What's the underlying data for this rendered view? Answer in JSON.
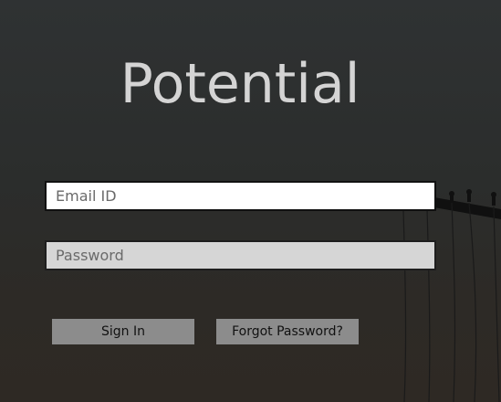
{
  "app": {
    "title": "Potential"
  },
  "login_form": {
    "email_placeholder": "Email ID",
    "email_value": "",
    "password_placeholder": "Password",
    "password_value": "",
    "sign_in_label": "Sign In",
    "forgot_password_label": "Forgot Password?"
  },
  "colors": {
    "background_top": "#2f3233",
    "background_bottom": "#2e2924",
    "title_text": "#d4d4d4",
    "email_field_bg": "#ffffff",
    "password_field_bg": "#d6d6d6",
    "button_bg": "#8c8c8c"
  }
}
